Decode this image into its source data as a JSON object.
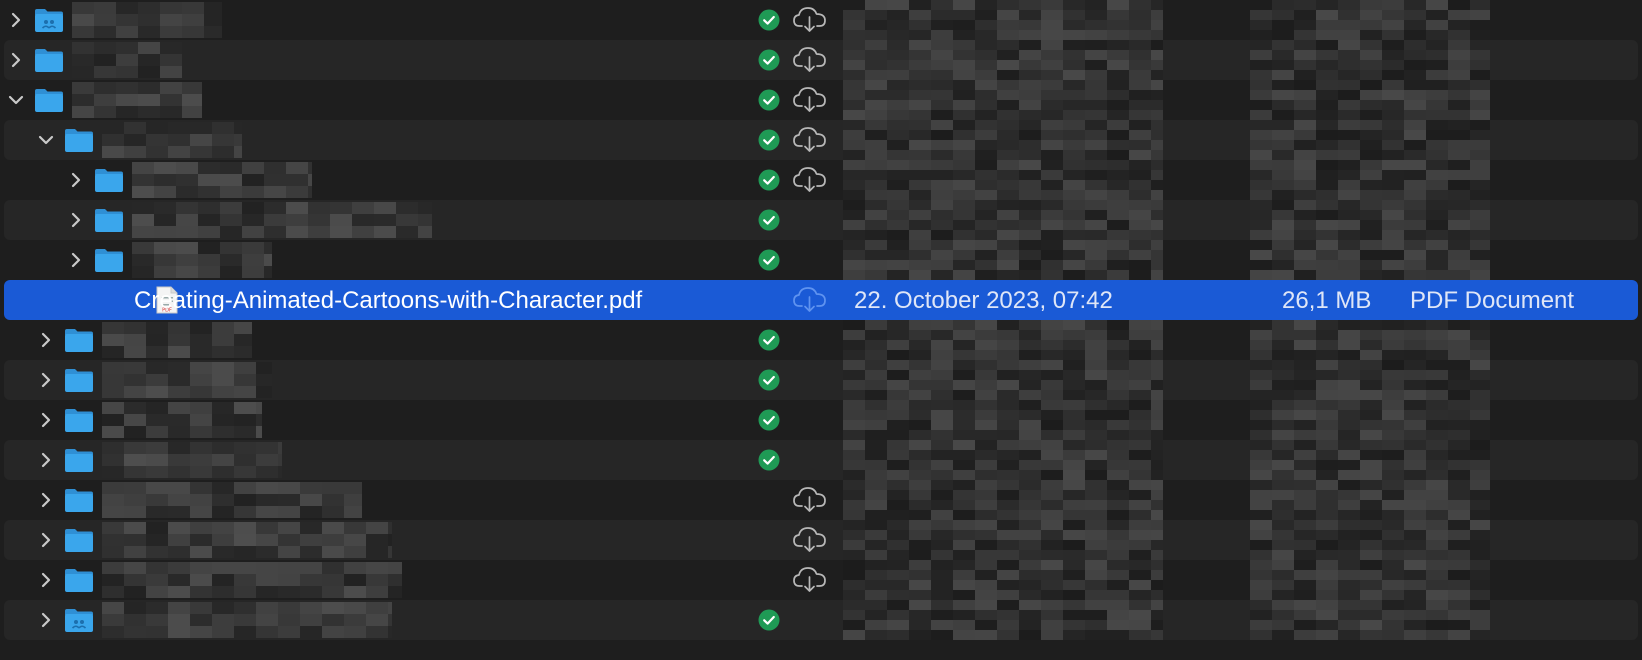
{
  "selected_file": {
    "name": "Creating-Animated-Cartoons-with-Character.pdf",
    "date_modified": "22. October 2023, 07:42",
    "size": "26,1 MB",
    "kind": "PDF Document",
    "icon": "pdf-document-icon",
    "sync_status_icon": "cloud-download-icon"
  },
  "rows": [
    {
      "level": 0,
      "expanded": false,
      "folder_variant": "shared",
      "synced": true,
      "cloud": true
    },
    {
      "level": 0,
      "expanded": false,
      "folder_variant": "plain",
      "synced": true,
      "cloud": true
    },
    {
      "level": 0,
      "expanded": true,
      "folder_variant": "plain",
      "synced": true,
      "cloud": true
    },
    {
      "level": 1,
      "expanded": true,
      "folder_variant": "plain",
      "synced": true,
      "cloud": true
    },
    {
      "level": 2,
      "expanded": false,
      "folder_variant": "plain",
      "synced": true,
      "cloud": true
    },
    {
      "level": 2,
      "expanded": false,
      "folder_variant": "plain",
      "synced": true,
      "cloud": false
    },
    {
      "level": 2,
      "expanded": false,
      "folder_variant": "plain",
      "synced": true,
      "cloud": false
    },
    {
      "level": 2,
      "selected": true,
      "file": true
    },
    {
      "level": 1,
      "expanded": false,
      "folder_variant": "plain",
      "synced": true,
      "cloud": false
    },
    {
      "level": 1,
      "expanded": false,
      "folder_variant": "plain",
      "synced": true,
      "cloud": false
    },
    {
      "level": 1,
      "expanded": false,
      "folder_variant": "plain",
      "synced": true,
      "cloud": false
    },
    {
      "level": 1,
      "expanded": false,
      "folder_variant": "plain",
      "synced": true,
      "cloud": false
    },
    {
      "level": 1,
      "expanded": false,
      "folder_variant": "plain",
      "synced": false,
      "cloud": true
    },
    {
      "level": 1,
      "expanded": false,
      "folder_variant": "plain",
      "synced": false,
      "cloud": true
    },
    {
      "level": 1,
      "expanded": false,
      "folder_variant": "plain",
      "synced": false,
      "cloud": true
    },
    {
      "level": 1,
      "expanded": false,
      "folder_variant": "shared",
      "synced": true,
      "cloud": false
    }
  ],
  "colors": {
    "background": "#1e1e1e",
    "alternate_row": "#262626",
    "selection": "#1a5ad6",
    "folder_blue": "#3aa6ec",
    "sync_check_green": "#1f9a55",
    "cloud_outline": "#b8b8b8"
  }
}
